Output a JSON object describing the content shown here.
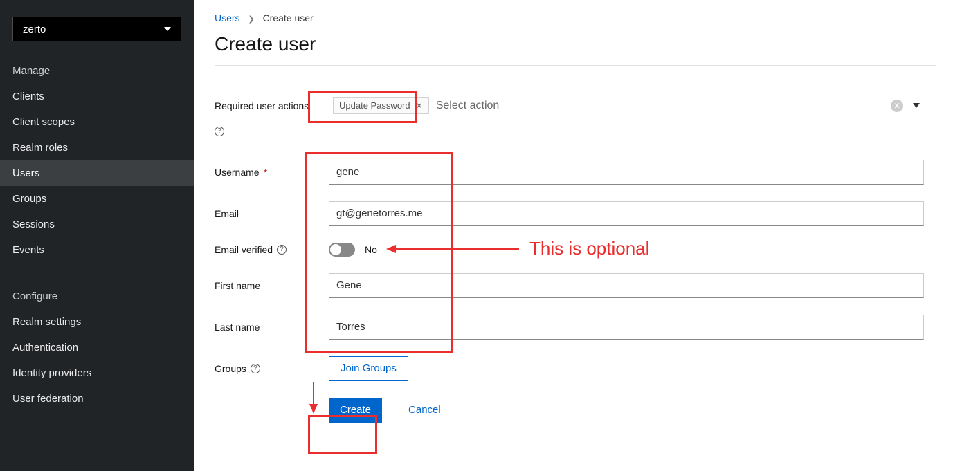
{
  "sidebar": {
    "realm": "zerto",
    "section_manage": "Manage",
    "section_configure": "Configure",
    "manage_items": [
      {
        "label": "Clients",
        "active": false
      },
      {
        "label": "Client scopes",
        "active": false
      },
      {
        "label": "Realm roles",
        "active": false
      },
      {
        "label": "Users",
        "active": true
      },
      {
        "label": "Groups",
        "active": false
      },
      {
        "label": "Sessions",
        "active": false
      },
      {
        "label": "Events",
        "active": false
      }
    ],
    "configure_items": [
      {
        "label": "Realm settings"
      },
      {
        "label": "Authentication"
      },
      {
        "label": "Identity providers"
      },
      {
        "label": "User federation"
      }
    ]
  },
  "breadcrumb": {
    "root": "Users",
    "current": "Create user"
  },
  "page_title": "Create user",
  "form": {
    "required_actions": {
      "label": "Required user actions",
      "chip": "Update Password",
      "placeholder": "Select action"
    },
    "username": {
      "label": "Username",
      "value": "gene",
      "required": "*"
    },
    "email": {
      "label": "Email",
      "value": "gt@genetorres.me"
    },
    "email_verified": {
      "label": "Email verified",
      "value": "No"
    },
    "first_name": {
      "label": "First name",
      "value": "Gene"
    },
    "last_name": {
      "label": "Last name",
      "value": "Torres"
    },
    "groups": {
      "label": "Groups",
      "button": "Join Groups"
    }
  },
  "buttons": {
    "create": "Create",
    "cancel": "Cancel"
  },
  "annotations": {
    "optional_note": "This is optional"
  }
}
